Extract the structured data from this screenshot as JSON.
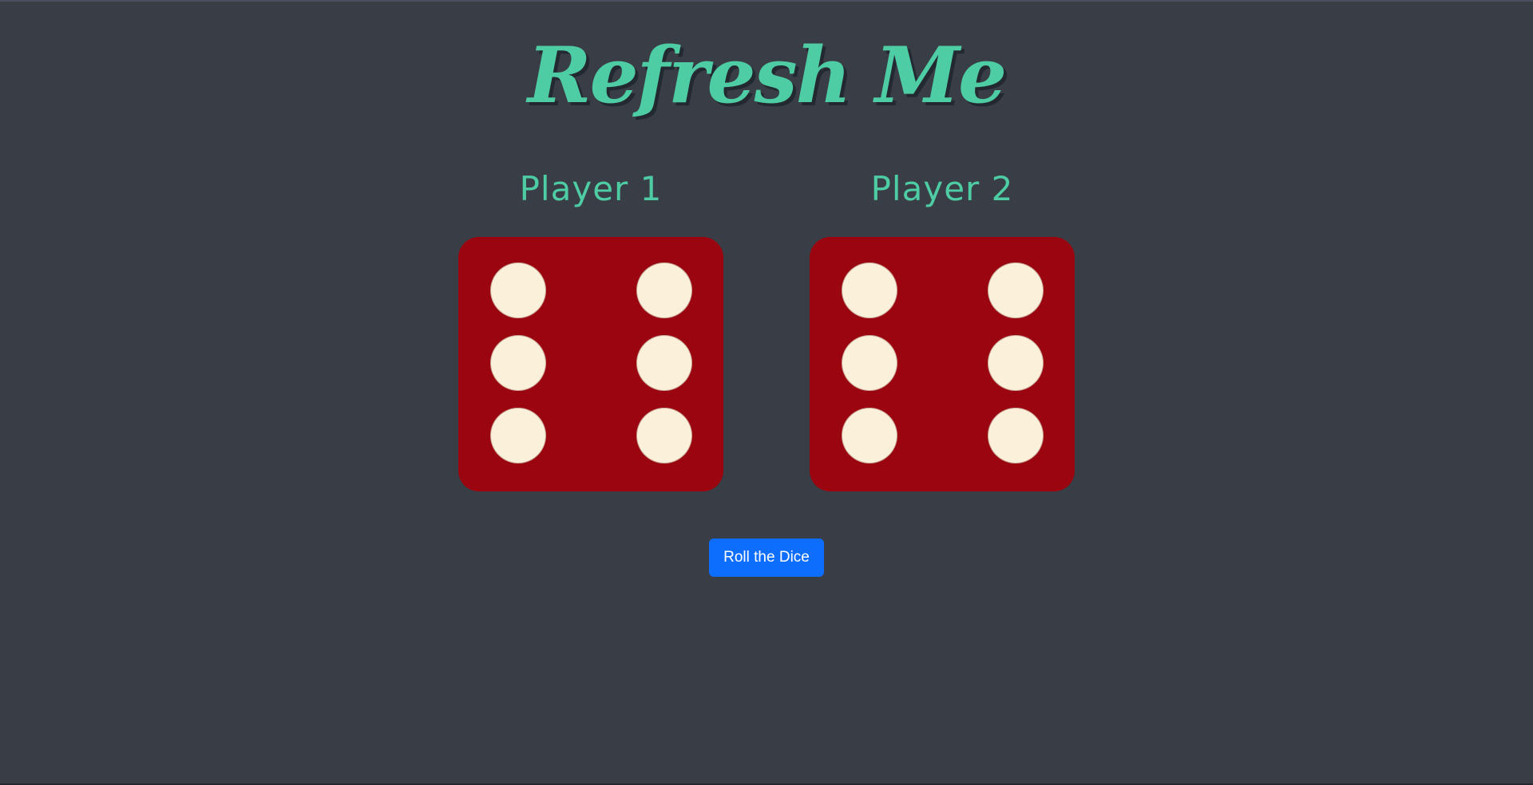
{
  "title": "Refresh Me",
  "players": [
    {
      "label": "Player 1",
      "die_value": 6
    },
    {
      "label": "Player 2",
      "die_value": 6
    }
  ],
  "roll_button": {
    "label": "Roll the Dice"
  },
  "colors": {
    "background": "#393e46",
    "accent": "#4ecca3",
    "die": "#9a050f",
    "pip": "#fbf0d9",
    "button": "#0d6efd"
  }
}
